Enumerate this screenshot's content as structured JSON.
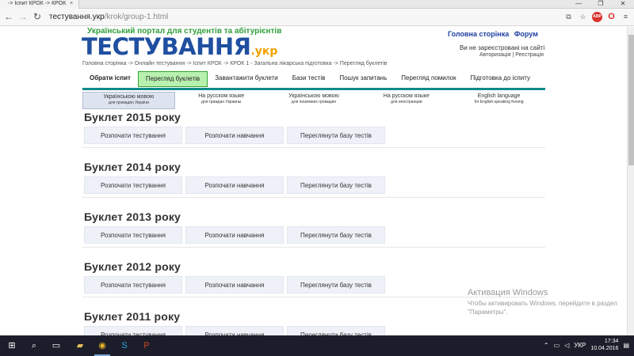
{
  "browser": {
    "tab_title": "-> Іспит КРОК -> КРОК",
    "tab_close": "×",
    "window_controls": [
      "—",
      "❐",
      "✕"
    ],
    "address_host": "тестування.укр",
    "address_path": "/krok/group-1.html",
    "back_glyph": "←",
    "forward_glyph": "→",
    "reload_glyph": "↻"
  },
  "site": {
    "slogan": "Український портал для студентів та абітурієнтів",
    "logo_main": "ТЕСТУВАННЯ",
    "logo_suffix": ".укр",
    "top_links": [
      "Головна сторінка",
      "Форум"
    ],
    "auth_status": "Ви не зареєстровані на сайті",
    "auth_login": "Авторизація",
    "auth_divider": "|",
    "auth_register": "Реєстрація",
    "breadcrumb": "Головна сторінка -> Онлайн тестування -> Іспит КРОК -> КРОК 1 - Загальна лікарська підготовка -> Перегляд буклетів"
  },
  "nav": [
    {
      "label": "Обрати іспит",
      "bold": true,
      "active": false
    },
    {
      "label": "Перегляд буклетів",
      "bold": false,
      "active": true
    },
    {
      "label": "Завантажити буклети",
      "bold": false,
      "active": false
    },
    {
      "label": "Бази тестів",
      "bold": false,
      "active": false
    },
    {
      "label": "Пошук запитань",
      "bold": false,
      "active": false
    },
    {
      "label": "Перегляд помилок",
      "bold": false,
      "active": false
    },
    {
      "label": "Підготовка до іспиту",
      "bold": false,
      "active": false
    }
  ],
  "languages": [
    {
      "title": "Українською мовою",
      "sub": "для громадян України",
      "active": true
    },
    {
      "title": "На русском языке",
      "sub": "для граждан Украины",
      "active": false
    },
    {
      "title": "Українською мовою",
      "sub": "для іноземних громадян",
      "active": false
    },
    {
      "title": "На русском языке",
      "sub": "для иностранцев",
      "active": false
    },
    {
      "title": "English language",
      "sub": "for English-speaking foreing",
      "active": false
    }
  ],
  "booklet_buttons": [
    "Розпочати тестування",
    "Розпочати навчання",
    "Переглянути базу тестів"
  ],
  "booklets": [
    "Буклет 2015 року",
    "Буклет 2014 року",
    "Буклет 2013 року",
    "Буклет 2012 року",
    "Буклет 2011 року"
  ],
  "watermark": {
    "title": "Активация Windows",
    "sub": "Чтобы активировать Windows, перейдите в раздел \"Параметры\"."
  },
  "taskbar": {
    "lang": "УКР",
    "time": "17:34",
    "date": "10.04.2016"
  }
}
